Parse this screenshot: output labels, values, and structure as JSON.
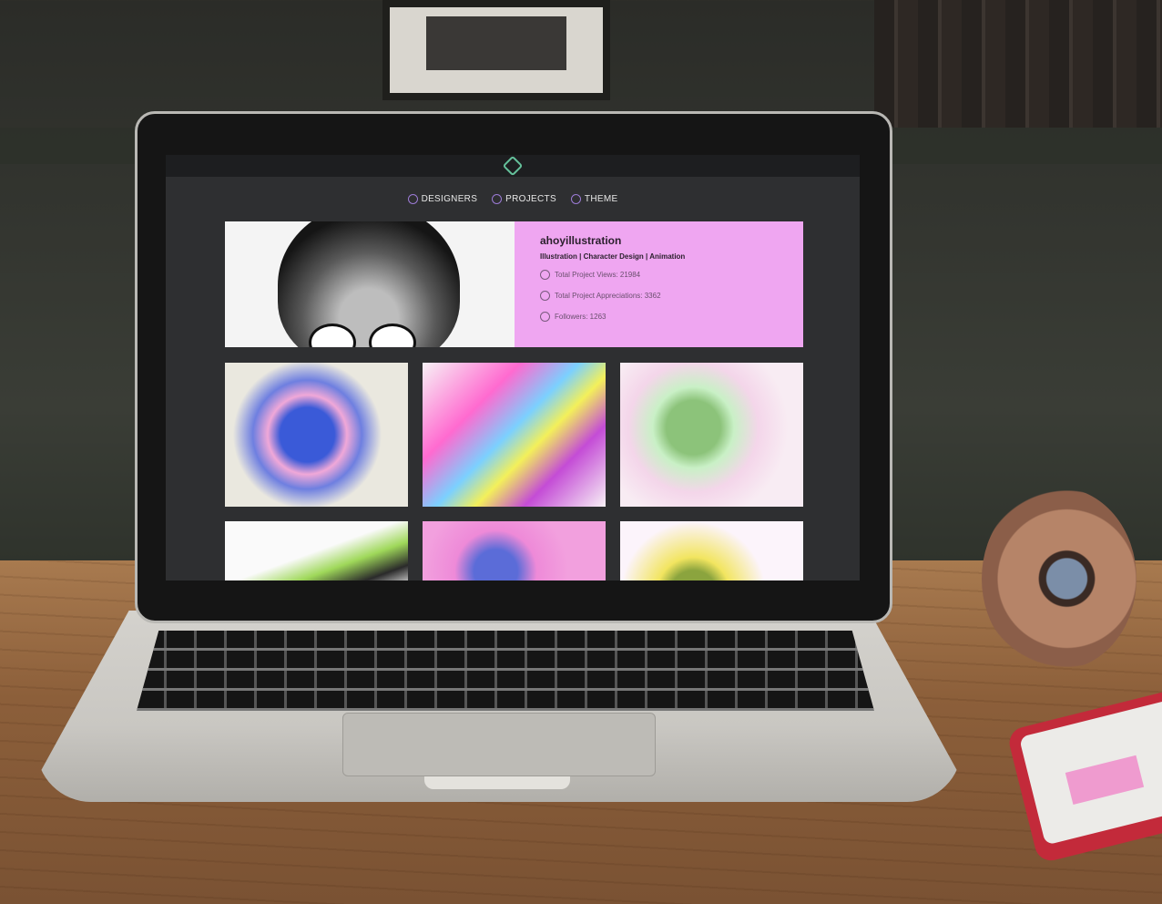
{
  "nav": {
    "items": [
      {
        "label": "DESIGNERS",
        "icon": "designers-icon"
      },
      {
        "label": "PROJECTS",
        "icon": "projects-icon"
      },
      {
        "label": "THEME",
        "icon": "theme-icon"
      }
    ]
  },
  "profile": {
    "name": "ahoyillustration",
    "tags": "Illustration | Character Design | Animation",
    "stats": [
      {
        "label": "Total Project Views: 21984",
        "icon": "eye-icon"
      },
      {
        "label": "Total Project Appreciations: 3362",
        "icon": "appreciation-icon"
      },
      {
        "label": "Followers: 1263",
        "icon": "followers-icon"
      }
    ]
  },
  "projects_count_visible": 6,
  "colors": {
    "accent_logo": "#64c09a",
    "profile_bg": "#efa6f1",
    "screen_bg": "#2e2f31"
  }
}
